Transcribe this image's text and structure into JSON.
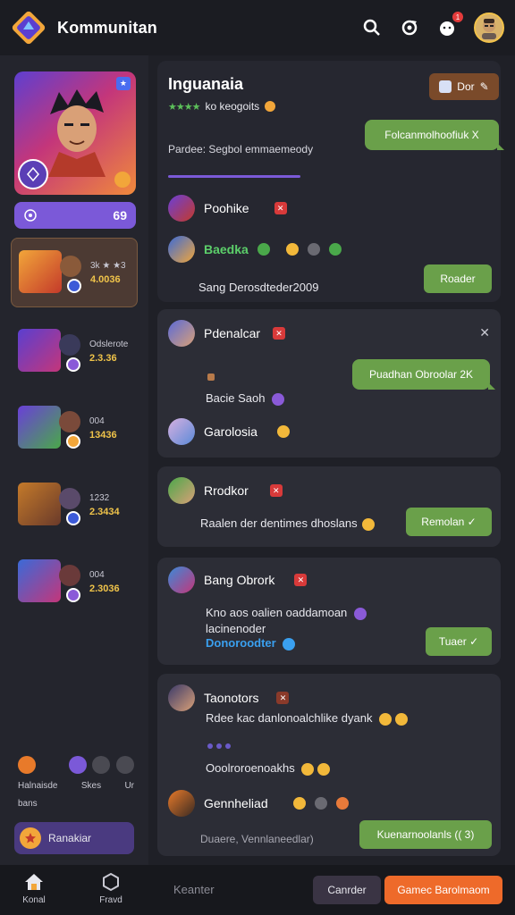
{
  "header": {
    "app_title": "Kommunitan",
    "notification_count": "1"
  },
  "sidebar": {
    "profile_bar_value": "69",
    "guilds": [
      {
        "code": "3k ★ ★3",
        "score": "4.0036"
      },
      {
        "code": "Odslerote",
        "score": "2.3.36"
      },
      {
        "code": "004",
        "score": "13436"
      },
      {
        "code": "1232",
        "score": "2.3434"
      },
      {
        "code": "004",
        "score": "2.3036"
      }
    ],
    "actions": {
      "label_1": "Halnaisde",
      "label_2": "Skes",
      "label_3": "Ur",
      "sublabel": "bans"
    },
    "cta_label": "Ranakiar"
  },
  "main": {
    "top_card": {
      "title": "Inguanaia",
      "rating_text": "ko keogoits",
      "button_label": "Dor",
      "description": "Pardee: Segbol emmaemeody",
      "bubble": "Folcanmolhoofiuk X"
    },
    "thread": [
      {
        "name": "Poohike"
      },
      {
        "name": "Baedka"
      }
    ],
    "top_card_text": "Sang Derosdteder2009",
    "top_card_button": "Roader",
    "card2": {
      "name": "Pdenalcar",
      "bubble": "Puadhan Obroolar 2K",
      "text": "Bacie Saoh",
      "name2": "Garolosia"
    },
    "card3": {
      "name": "Rrodkor",
      "text": "Raalen der dentimes dhoslans",
      "button": "Remolan ✓"
    },
    "card4": {
      "name": "Bang Obrork",
      "line1": "Kno aos oalien oaddamoan",
      "line2": "lacinenoder",
      "link": "Donoroodter",
      "button": "Tuaer ✓"
    },
    "card5": {
      "name": "Taonotors",
      "line1": "Rdee kac danlonoalchlike dyank",
      "line2": "Ooolroroenoakhs",
      "name2": "Gennheliad",
      "footer": "Duaere, Vennlaneedlar)",
      "button": "Kuenarnoolanls (( 3)"
    }
  },
  "bottom_bar": {
    "home_label": "Konal",
    "nav2_label": "Fravd",
    "input_label": "Keanter",
    "cancel_label": "Canrder",
    "primary_label": "Gamec Barolmaom"
  },
  "colors": {
    "accent_green": "#6aa04a",
    "accent_orange": "#ee6a2a",
    "accent_purple": "#7b59d8"
  }
}
